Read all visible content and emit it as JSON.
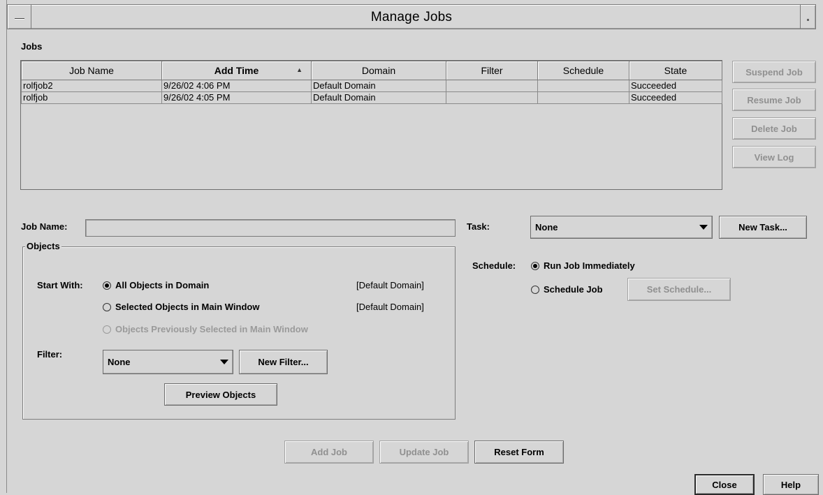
{
  "window": {
    "title": "Manage Jobs"
  },
  "jobs": {
    "section_label": "Jobs",
    "columns": [
      "Job Name",
      "Add Time",
      "Domain",
      "Filter",
      "Schedule",
      "State"
    ],
    "sorted_column": "Add Time",
    "rows": [
      [
        "rolfjob2",
        "9/26/02 4:06 PM",
        "Default Domain",
        "",
        "",
        "Succeeded"
      ],
      [
        "rolfjob",
        "9/26/02 4:05 PM",
        "Default Domain",
        "",
        "",
        "Succeeded"
      ]
    ]
  },
  "side_buttons": {
    "suspend": "Suspend Job",
    "resume": "Resume Job",
    "delete": "Delete Job",
    "view_log": "View Log"
  },
  "job_name": {
    "label": "Job Name:",
    "value": ""
  },
  "task": {
    "label": "Task:",
    "selected": "None",
    "new_button": "New Task..."
  },
  "objects": {
    "group_label": "Objects",
    "start_with_label": "Start With:",
    "options": [
      {
        "label": "All Objects in Domain",
        "domain": "[Default Domain]",
        "selected": true,
        "enabled": true
      },
      {
        "label": "Selected Objects in Main Window",
        "domain": "[Default Domain]",
        "selected": false,
        "enabled": true
      },
      {
        "label": "Objects Previously Selected in Main Window",
        "domain": "",
        "selected": false,
        "enabled": false
      }
    ],
    "filter_label": "Filter:",
    "filter_selected": "None",
    "new_filter_button": "New Filter...",
    "preview_button": "Preview Objects"
  },
  "schedule": {
    "label": "Schedule:",
    "run_immediately": "Run Job Immediately",
    "schedule_job": "Schedule Job",
    "set_schedule_button": "Set Schedule...",
    "selected": "run_immediately"
  },
  "form_buttons": {
    "add": "Add Job",
    "update": "Update Job",
    "reset": "Reset Form"
  },
  "dialog_buttons": {
    "close": "Close",
    "help": "Help"
  }
}
